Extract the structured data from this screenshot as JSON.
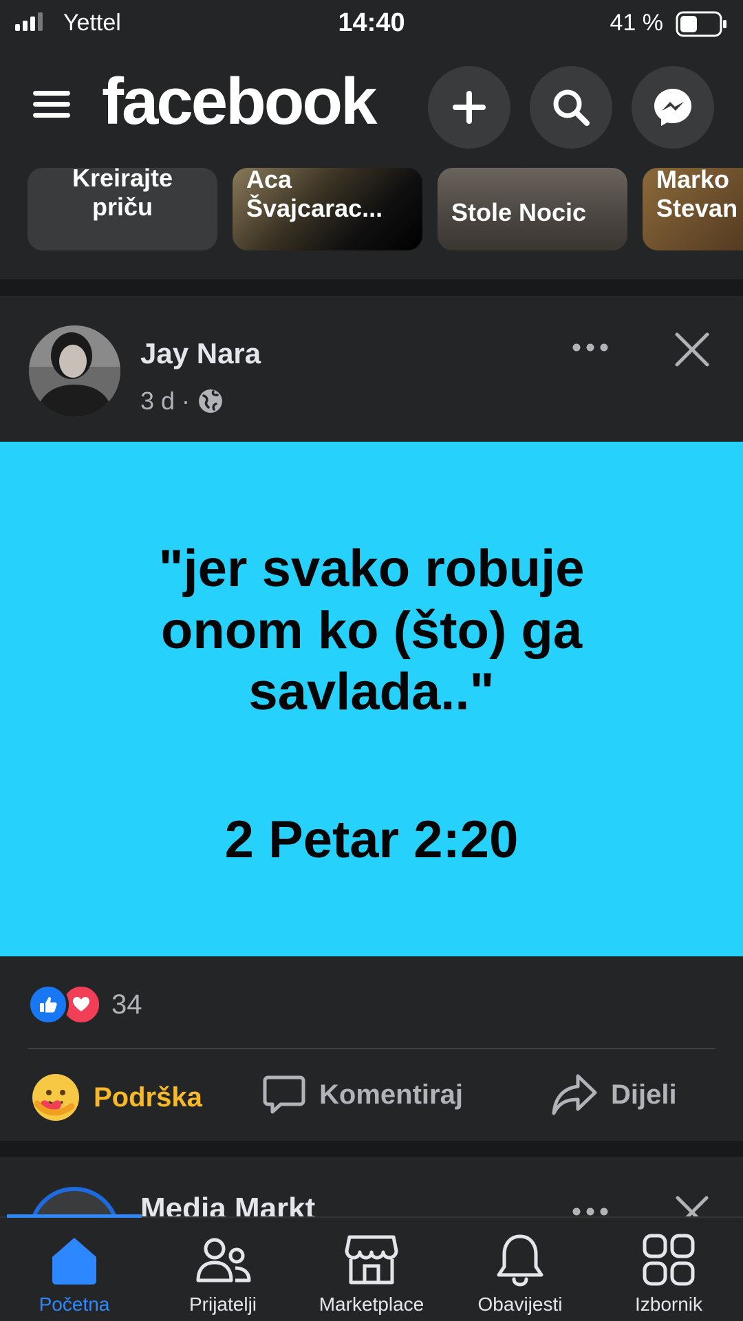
{
  "status_bar": {
    "carrier": "Yettel",
    "time": "14:40",
    "battery": "41 %"
  },
  "header": {
    "logo": "facebook",
    "icons": [
      "menu-icon",
      "plus-icon",
      "search-icon",
      "messenger-icon"
    ]
  },
  "stories": [
    {
      "label": "Kreirajte\npriču"
    },
    {
      "label": "Aca\nŠvajcarac..."
    },
    {
      "label": "Stole Nocic"
    },
    {
      "label": "Marko\nStevan"
    }
  ],
  "post": {
    "author": "Jay Nara",
    "time": "3 d",
    "separator": "·",
    "privacy_icon": "globe-icon",
    "quote": "\"jer svako robuje\nonom ko (što) ga\nsavlada..\"",
    "reference": "2 Petar 2:20",
    "image_bg": "#26d1fc",
    "reaction_count": "34",
    "actions": {
      "support": "Podrška",
      "comment": "Komentiraj",
      "share": "Dijeli"
    }
  },
  "next_post": {
    "author": "Media Markt"
  },
  "bottom_nav": [
    {
      "label": "Početna",
      "icon": "home-icon",
      "active": true
    },
    {
      "label": "Prijatelji",
      "icon": "friends-icon",
      "active": false
    },
    {
      "label": "Marketplace",
      "icon": "marketplace-icon",
      "active": false
    },
    {
      "label": "Obavijesti",
      "icon": "bell-icon",
      "active": false
    },
    {
      "label": "Izbornik",
      "icon": "menu-grid-icon",
      "active": false
    }
  ],
  "colors": {
    "accent": "#2d88ff",
    "support": "#f7b928",
    "background": "#242526"
  }
}
